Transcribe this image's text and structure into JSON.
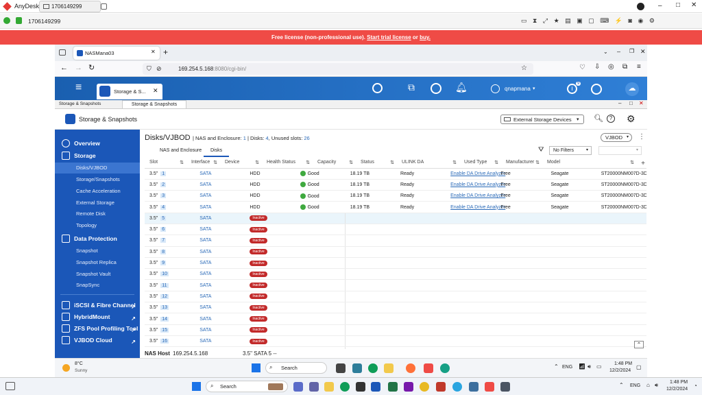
{
  "anydesk": {
    "app_name": "AnyDesk",
    "tab_label": "1706149299",
    "address": "1706149299"
  },
  "banner": {
    "prefix": "Free license (non-professional use).",
    "trial_link": "Start trial license",
    "or": "or",
    "buy_link": "buy."
  },
  "browser": {
    "tab_title": "NASMana03",
    "url_host": "169.254.5.168",
    "url_rest": ":8080/cgi-bin/"
  },
  "qts": {
    "app_tab_label": "Storage & S...",
    "user": "qnapmana",
    "notification_count": "9",
    "window_tab": "Storage & Snapshots",
    "window_label": "Storage & Snapshots",
    "app_title": "Storage & Snapshots",
    "external_dropdown": "External Storage Devices"
  },
  "sidebar": {
    "overview": "Overview",
    "storage": "Storage",
    "storage_items": [
      "Disks/VJBOD",
      "Storage/Snapshots",
      "Cache Acceleration",
      "External Storage",
      "Remote Disk",
      "Topology"
    ],
    "data_protection": "Data Protection",
    "dp_items": [
      "Snapshot",
      "Snapshot Replica",
      "Snapshot Vault",
      "SnapSync"
    ],
    "links": [
      "iSCSI & Fibre Channel",
      "HybridMount",
      "ZFS Pool Profiling Tool",
      "VJBOD Cloud"
    ]
  },
  "content": {
    "title": "Disks/VJBOD",
    "summary_label1": "NAS and Enclosure:",
    "summary_val1": "1",
    "summary_label2": "Disks:",
    "summary_val2": "4",
    "summary_label3": "Unused slots:",
    "summary_val3": "26",
    "tab1": "NAS and Enclosure",
    "tab2": "Disks",
    "filter": "No Filters",
    "vjbod_button": "VJBOD",
    "columns": [
      "Slot",
      "Interface",
      "Device",
      "Health Status",
      "Capacity",
      "Status",
      "ULINK DA",
      "Used Type",
      "Manufacturer",
      "Model"
    ]
  },
  "disks": [
    {
      "slot": "3.5\"",
      "n": "1",
      "iface": "SATA",
      "device": "HDD",
      "health": "Good",
      "cap": "18.19 TB",
      "status": "Ready",
      "ulink": "Enable DA Drive Analyzer",
      "used": "Free",
      "mfr": "Seagate",
      "model": "ST20000NM007D-3DJ103"
    },
    {
      "slot": "3.5\"",
      "n": "2",
      "iface": "SATA",
      "device": "HDD",
      "health": "Good",
      "cap": "18.19 TB",
      "status": "Ready",
      "ulink": "Enable DA Drive Analyzer",
      "used": "Free",
      "mfr": "Seagate",
      "model": "ST20000NM007D-3DJ103"
    },
    {
      "slot": "3.5\"",
      "n": "3",
      "iface": "SATA",
      "device": "HDD",
      "health": "Good",
      "cap": "18.19 TB",
      "status": "Ready",
      "ulink": "Enable DA Drive Analyzer",
      "used": "Free",
      "mfr": "Seagate",
      "model": "ST20000NM007D-3DJ103"
    },
    {
      "slot": "3.5\"",
      "n": "4",
      "iface": "SATA",
      "device": "HDD",
      "health": "Good",
      "cap": "18.19 TB",
      "status": "Ready",
      "ulink": "Enable DA Drive Analyzer",
      "used": "Free",
      "mfr": "Seagate",
      "model": "ST20000NM007D-3DJ103"
    }
  ],
  "empty_slots": {
    "slot": "3.5\"",
    "iface": "SATA",
    "badge": "Inactive",
    "numbers": [
      "5",
      "6",
      "7",
      "8",
      "9",
      "10",
      "11",
      "12",
      "13",
      "14",
      "15",
      "16",
      "17"
    ]
  },
  "status_bar": {
    "host_label": "NAS Host",
    "host_ip": "169.254.5.168",
    "selected": "3.5\" SATA 5 --"
  },
  "remote_taskbar": {
    "weather_temp": "8°C",
    "weather_desc": "Sunny",
    "search": "Search",
    "lang": "ENG",
    "time": "1:48 PM",
    "date": "12/2/2024"
  },
  "local_taskbar": {
    "search": "Search",
    "lang": "ENG",
    "time": "1:48 PM",
    "date": "12/2/2024"
  }
}
